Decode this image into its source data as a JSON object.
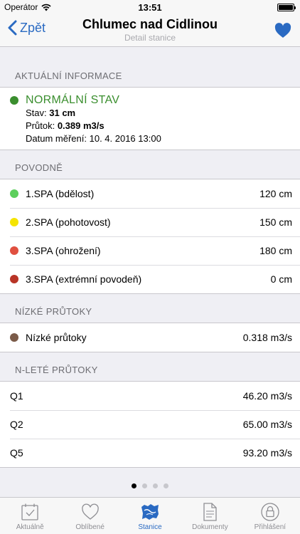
{
  "status_bar": {
    "carrier": "Operátor",
    "time": "13:51"
  },
  "nav": {
    "back_label": "Zpět",
    "title": "Chlumec nad Cidlinou",
    "subtitle": "Detail stanice"
  },
  "current": {
    "header": "AKTUÁLNÍ INFORMACE",
    "status": "NORMÁLNÍ STAV",
    "status_color": "#3a8e2e",
    "stav_label": "Stav:",
    "stav_value": "31 cm",
    "prutok_label": "Průtok:",
    "prutok_value": "0.389 m3/s",
    "datum_label": "Datum měření:",
    "datum_value": "10. 4. 2016 13:00"
  },
  "floods": {
    "header": "POVODNĚ",
    "items": [
      {
        "label": "1.SPA (bdělost)",
        "value": "120 cm",
        "color": "#5ccf5c"
      },
      {
        "label": "2.SPA (pohotovost)",
        "value": "150 cm",
        "color": "#f5e400"
      },
      {
        "label": "3.SPA (ohrožení)",
        "value": "180 cm",
        "color": "#e05040"
      },
      {
        "label": "3.SPA (extrémní povodeň)",
        "value": "0 cm",
        "color": "#b83426"
      }
    ]
  },
  "low_flows": {
    "header": "NÍZKÉ PRŮTOKY",
    "items": [
      {
        "label": "Nízké průtoky",
        "value": "0.318 m3/s",
        "color": "#7a5a48"
      }
    ]
  },
  "n_year": {
    "header": "N-LETÉ PRŮTOKY",
    "items": [
      {
        "label": "Q1",
        "value": "46.20 m3/s"
      },
      {
        "label": "Q2",
        "value": "65.00 m3/s"
      },
      {
        "label": "Q5",
        "value": "93.20 m3/s"
      }
    ]
  },
  "pager": {
    "count": 4,
    "active": 0
  },
  "tabs": [
    {
      "label": "Aktuálně",
      "icon": "calendar-icon"
    },
    {
      "label": "Oblíbené",
      "icon": "heart-icon"
    },
    {
      "label": "Stanice",
      "icon": "map-icon"
    },
    {
      "label": "Dokumenty",
      "icon": "document-icon"
    },
    {
      "label": "Přihlášení",
      "icon": "lock-icon"
    }
  ],
  "accent_color": "#2a6ac2"
}
